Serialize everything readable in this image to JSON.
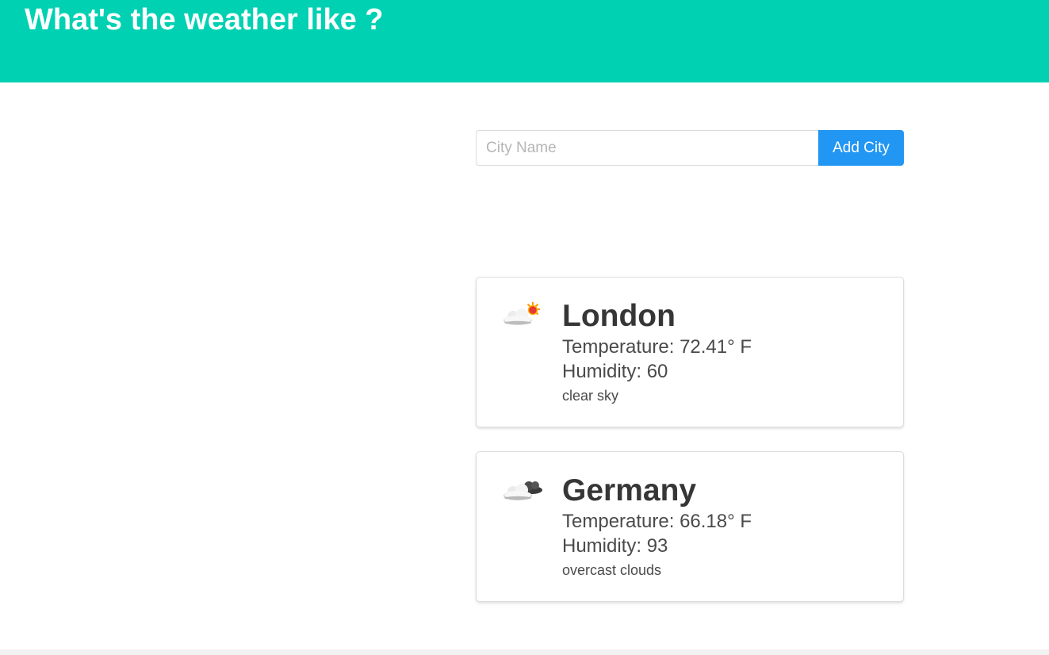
{
  "header": {
    "title": "What's the weather like ?",
    "background": "#00d1b2"
  },
  "search": {
    "placeholder": "City Name",
    "value": "",
    "button_label": "Add City",
    "button_color": "#2196f3"
  },
  "cities": [
    {
      "name": "London",
      "temperature": "Temperature: 72.41° F",
      "humidity": "Humidity: 60",
      "description": "clear sky",
      "icon": "partly-sunny-icon"
    },
    {
      "name": "Germany",
      "temperature": "Temperature: 66.18° F",
      "humidity": "Humidity: 93",
      "description": "overcast clouds",
      "icon": "overcast-clouds-icon"
    }
  ]
}
